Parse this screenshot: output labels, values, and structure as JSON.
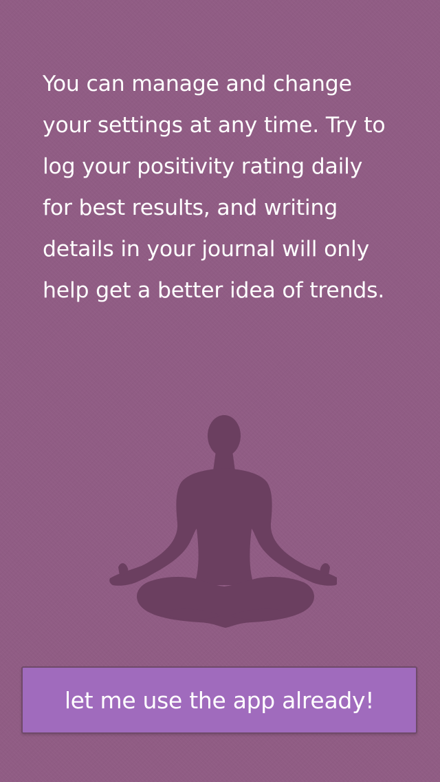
{
  "intro": {
    "lines": [
      "You can manage and change",
      "your settings at any time. Try to",
      "log your positivity rating daily",
      "for best results, and writing",
      "details in your journal will only",
      "help get a better idea of trends."
    ]
  },
  "illustration": {
    "icon": "meditation-pose-icon",
    "color": "#6b3f60"
  },
  "cta": {
    "label": "let me use the app already!",
    "background": "#a06bbd"
  },
  "colors": {
    "background": "#905c84",
    "text": "#ffffff"
  }
}
